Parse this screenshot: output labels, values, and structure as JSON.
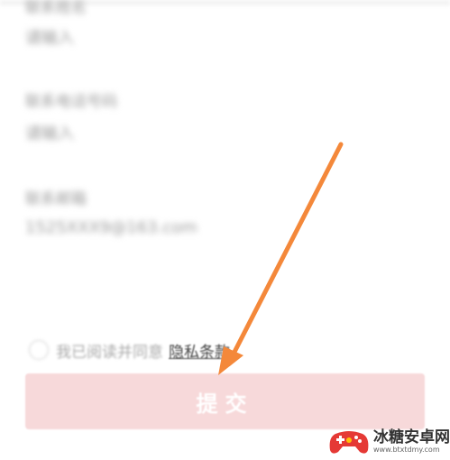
{
  "form": {
    "fields": [
      {
        "label": "联系姓名",
        "value": "请输入"
      },
      {
        "label": "联系电话号码",
        "value": "请输入"
      },
      {
        "label": "联系邮箱",
        "value": "1525XXX9@163.com"
      }
    ]
  },
  "agreement": {
    "text": "我已阅读并同意",
    "link_label": "隐私条款"
  },
  "submit": {
    "label": "提交",
    "color": "#f7d9da"
  },
  "annotation": {
    "arrow_color": "#f4883a"
  },
  "watermark": {
    "name": "冰糖安卓网",
    "url": "www.btxtdmy.com",
    "logo_icon": "gamepad-logo-icon"
  }
}
